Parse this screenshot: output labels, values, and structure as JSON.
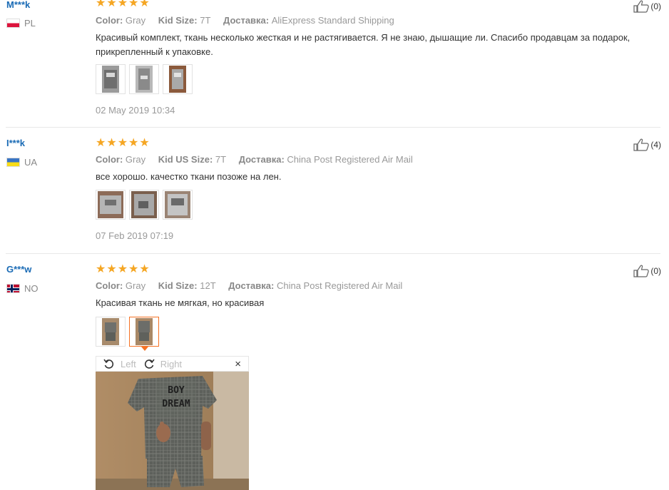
{
  "reviews": [
    {
      "user": "M***k",
      "country": "PL",
      "flag": "pl",
      "rating": 5,
      "color_label": "Color:",
      "color": "Gray",
      "size_label": "Kid Size:",
      "size": "7T",
      "shipping_label": "Доставка:",
      "shipping": "AliExpress Standard Shipping",
      "text": "Красивый комплект, ткань несколько жесткая и не растягивается. Я не знаю, дышащие ли. Спасибо продавцам за подарок, прикрепленный к упаковке.",
      "photos": 3,
      "date": "02 May 2019 10:34",
      "likes": "(0)"
    },
    {
      "user": "I***k",
      "country": "UA",
      "flag": "ua",
      "rating": 5,
      "color_label": "Color:",
      "color": "Gray",
      "size_label": "Kid US Size:",
      "size": "7T",
      "shipping_label": "Доставка:",
      "shipping": "China Post Registered Air Mail",
      "text": "все хорошо. качестко ткани позоже на лен.",
      "photos": 3,
      "date": "07 Feb 2019 07:19",
      "likes": "(4)"
    },
    {
      "user": "G***w",
      "country": "NO",
      "flag": "no",
      "rating": 5,
      "color_label": "Color:",
      "color": "Gray",
      "size_label": "Kid Size:",
      "size": "12T",
      "shipping_label": "Доставка:",
      "shipping": "China Post Registered Air Mail",
      "text": "Красивая ткань не мягкая, но красивая",
      "photos": 2,
      "likes": "(0)"
    }
  ],
  "viewer": {
    "rotate_left": "Left",
    "rotate_right": "Right",
    "close": "×",
    "shirt_print_line1": "BOY",
    "shirt_print_line2": "DREAM"
  },
  "colors": {
    "username": "#1a6bb5",
    "star": "#f5a623",
    "active_thumb": "#f57224"
  }
}
